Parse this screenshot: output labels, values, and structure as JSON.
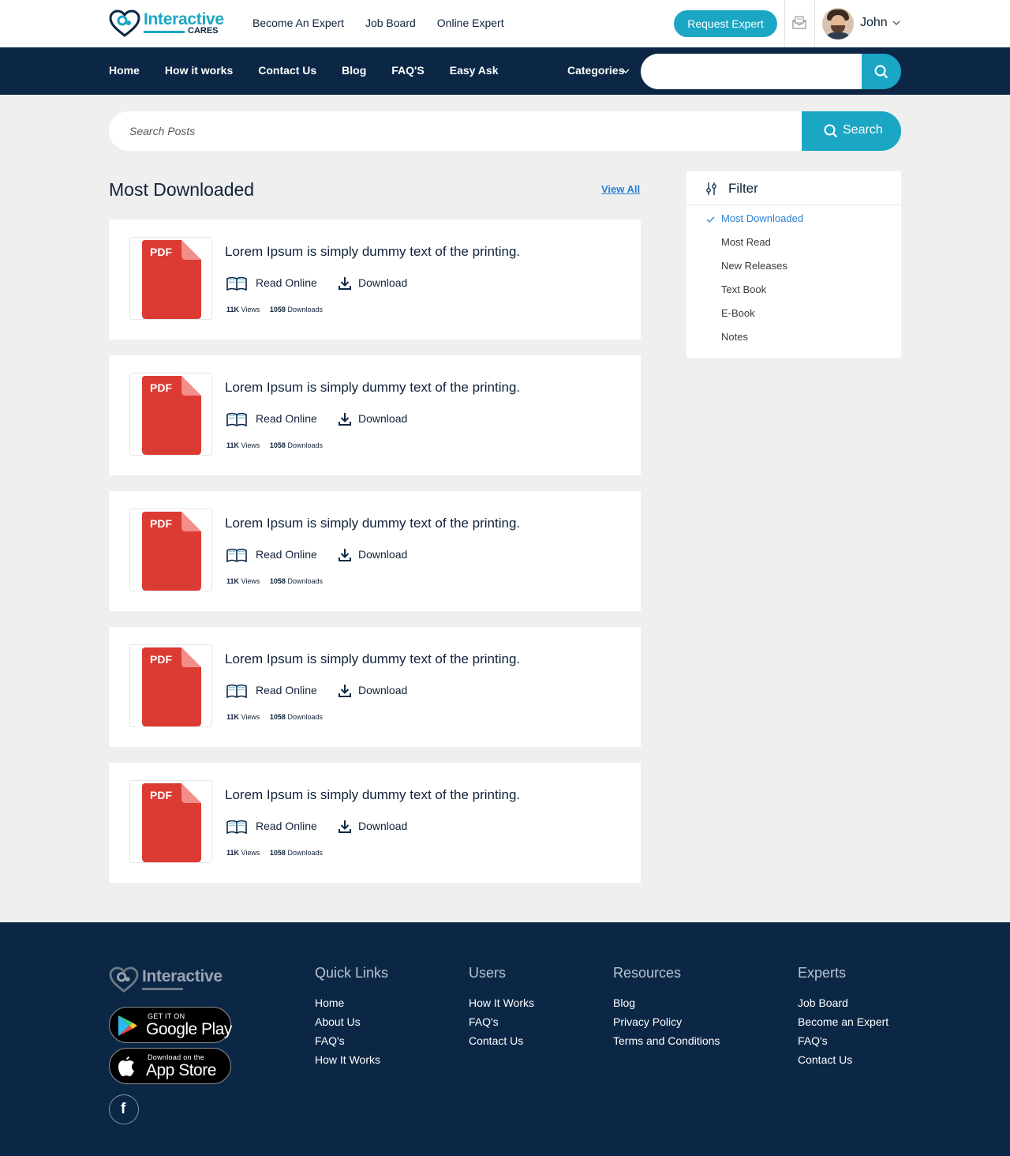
{
  "brand": {
    "name": "Interactive",
    "sub": "CARES",
    "accent": "#1ba6c4",
    "navy": "#0b2745"
  },
  "topbar": {
    "links": [
      "Become An Expert",
      "Job Board",
      "Online Expert"
    ],
    "request_button": "Request Expert",
    "user_name": "John"
  },
  "navbar": {
    "links": [
      "Home",
      "How it works",
      "Contact Us",
      "Blog",
      "FAQ'S",
      "Easy Ask"
    ],
    "categories": "Categories",
    "search_placeholder": ""
  },
  "post_search": {
    "placeholder": "Search Posts",
    "button": "Search"
  },
  "section": {
    "title": "Most Downloaded",
    "view_all": "View All"
  },
  "cards": [
    {
      "title": "Lorem Ipsum is simply dummy text of the printing.",
      "badge": "PDF",
      "read": "Read Online",
      "download": "Download",
      "views_num": "11K",
      "views_label": "Views",
      "downloads_num": "1058",
      "downloads_label": "Downloads"
    },
    {
      "title": "Lorem Ipsum is simply dummy text of the printing.",
      "badge": "PDF",
      "read": "Read Online",
      "download": "Download",
      "views_num": "11K",
      "views_label": "Views",
      "downloads_num": "1058",
      "downloads_label": "Downloads"
    },
    {
      "title": "Lorem Ipsum is simply dummy text of the printing.",
      "badge": "PDF",
      "read": "Read Online",
      "download": "Download",
      "views_num": "11K",
      "views_label": "Views",
      "downloads_num": "1058",
      "downloads_label": "Downloads"
    },
    {
      "title": "Lorem Ipsum is simply dummy text of the printing.",
      "badge": "PDF",
      "read": "Read Online",
      "download": "Download",
      "views_num": "11K",
      "views_label": "Views",
      "downloads_num": "1058",
      "downloads_label": "Downloads"
    },
    {
      "title": "Lorem Ipsum is simply dummy text of the printing.",
      "badge": "PDF",
      "read": "Read Online",
      "download": "Download",
      "views_num": "11K",
      "views_label": "Views",
      "downloads_num": "1058",
      "downloads_label": "Downloads"
    }
  ],
  "filter": {
    "title": "Filter",
    "items": [
      "Most Downloaded",
      "Most Read",
      "New Releases",
      "Text Book",
      "E-Book",
      "Notes"
    ],
    "selected": "Most Downloaded"
  },
  "footer": {
    "logo_text": "Interactive",
    "google_play": {
      "small": "GET IT ON",
      "big": "Google Play"
    },
    "app_store": {
      "small": "Download on the",
      "big": "App Store"
    },
    "facebook": "f",
    "columns": [
      {
        "title": "Quick Links",
        "items": [
          "Home",
          "About Us",
          "FAQ's",
          "How It Works"
        ]
      },
      {
        "title": "Users",
        "items": [
          "How It Works",
          "FAQ's",
          "Contact Us"
        ]
      },
      {
        "title": "Resources",
        "items": [
          "Blog",
          "Privacy Policy",
          "Terms and Conditions"
        ]
      },
      {
        "title": "Experts",
        "items": [
          "Job Board",
          "Become an Expert",
          "FAQ's",
          "Contact Us"
        ]
      }
    ]
  }
}
